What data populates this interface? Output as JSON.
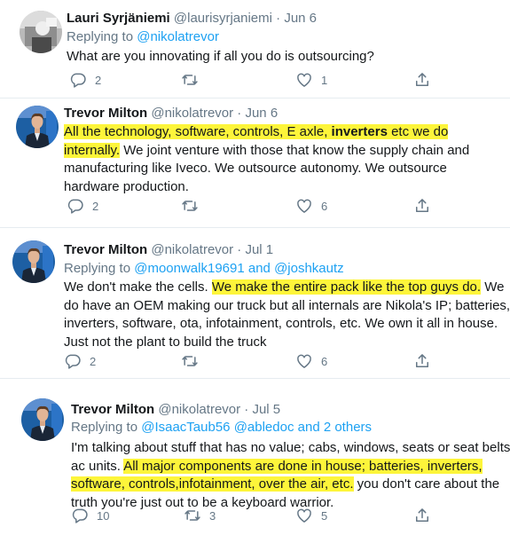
{
  "tweets": [
    {
      "name": "Lauri Syrjäniemi",
      "handle": "@laurisyrjaniemi",
      "dot": "·",
      "date": "Jun 6",
      "replying_prefix": "Replying to",
      "replying_to": [
        "@nikolatrevor"
      ],
      "lines": [
        [
          {
            "t": "What are you innovating if all you do is outsourcing?"
          }
        ]
      ],
      "replies": "2",
      "retweets": "",
      "likes": "1",
      "share": ""
    },
    {
      "name": "Trevor Milton",
      "handle": "@nikolatrevor",
      "dot": "·",
      "date": "Jun 6",
      "lines": [
        [
          {
            "t": "All the technology, software, controls, E axle, ",
            "h": true
          },
          {
            "t": "inverters",
            "h": true,
            "b": true
          },
          {
            "t": " etc we do",
            "h": true
          }
        ],
        [
          {
            "t": "internally.",
            "h": true
          },
          {
            "t": " We joint venture with those that know the supply chain and"
          }
        ],
        [
          {
            "t": "manufacturing like Iveco. We outsource autonomy. We outsource"
          }
        ],
        [
          {
            "t": "hardware production."
          }
        ]
      ],
      "replies": "2",
      "retweets": "",
      "likes": "6",
      "share": ""
    },
    {
      "name": "Trevor Milton",
      "handle": "@nikolatrevor",
      "dot": "·",
      "date": "Jul 1",
      "replying_prefix": "Replying to",
      "replying_to": [
        "@moonwalk19691",
        "and",
        "@joshkautz"
      ],
      "lines": [
        [
          {
            "t": "We don't make the cells. "
          },
          {
            "t": "We make the entire pack like the top guys do.",
            "h": true
          },
          {
            "t": " We"
          }
        ],
        [
          {
            "t": "do have an OEM making our truck but all internals are Nikola's IP; batteries,"
          }
        ],
        [
          {
            "t": "inverters, software, ota, infotainment, controls, etc. We own it all in house."
          }
        ],
        [
          {
            "t": "Just not the plant to build the truck"
          }
        ]
      ],
      "replies": "2",
      "retweets": "",
      "likes": "6",
      "share": ""
    },
    {
      "name": "Trevor Milton",
      "handle": "@nikolatrevor",
      "dot": "·",
      "date": "Jul 5",
      "replying_prefix": "Replying to",
      "replying_to": [
        "@IsaacTaub56",
        "@abledoc",
        "and 2 others"
      ],
      "lines": [
        [
          {
            "t": "I'm talking about stuff that has no value; cabs, windows, seats or seat belts or"
          }
        ],
        [
          {
            "t": "ac units. "
          },
          {
            "t": "All major components are done in house; batteries, inverters,",
            "h": true
          }
        ],
        [
          {
            "t": "software, controls,infotainment, over the air, etc.",
            "h": true
          },
          {
            "t": " you don't care about the"
          }
        ],
        [
          {
            "t": "truth you're just out to be a keyboard warrior."
          }
        ]
      ],
      "replies": "10",
      "retweets": "3",
      "likes": "5",
      "share": ""
    }
  ],
  "colors": {
    "highlight": "#fdf53a",
    "link": "#1da1f2",
    "muted": "#657786",
    "text": "#14171a",
    "separator": "#e6ecf0"
  },
  "icons": [
    "reply-icon",
    "retweet-icon",
    "like-icon",
    "share-icon"
  ]
}
